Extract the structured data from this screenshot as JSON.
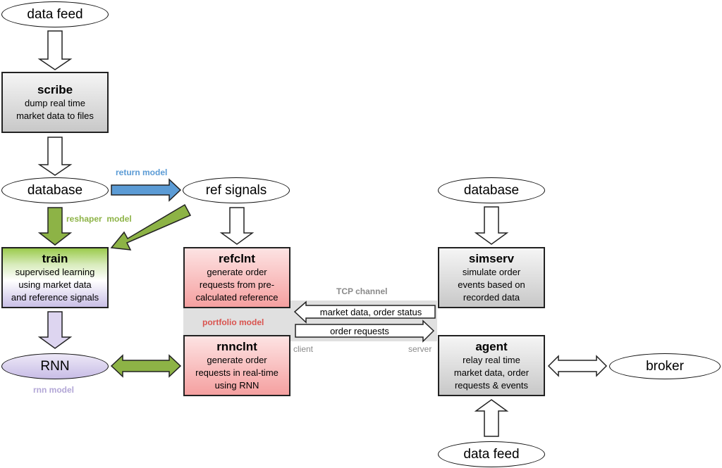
{
  "diagram": {
    "colors": {
      "return_model": "#5b9bd5",
      "reshaper_model": "#8db346",
      "rnn_model": "#b2a6d6",
      "portfolio_model": "#d9534f",
      "tcp_label": "#8a8a8a"
    },
    "ellipses": {
      "data_feed_top": "data feed",
      "database_left": "database",
      "ref_signals": "ref signals",
      "database_right": "database",
      "rnn": "RNN",
      "broker": "broker",
      "data_feed_bottom": "data feed"
    },
    "boxes": {
      "scribe": {
        "title": "scribe",
        "desc": "dump real time\nmarket data to files"
      },
      "train": {
        "title": "train",
        "desc": "supervised learning\nusing market data\nand reference signals"
      },
      "refclnt": {
        "title": "refclnt",
        "desc": "generate order\nrequests from pre-\ncalculated reference"
      },
      "rnnclnt": {
        "title": "rnnclnt",
        "desc": "generate order\nrequests in real-time\nusing RNN"
      },
      "simserv": {
        "title": "simserv",
        "desc": "simulate order\nevents based on\nrecorded data"
      },
      "agent": {
        "title": "agent",
        "desc": "relay real time\nmarket data, order\nrequests & events"
      }
    },
    "labels": {
      "return_model": "return model",
      "reshaper_model": "reshaper  model",
      "rnn_model": "rnn model",
      "portfolio_model": "portfolio model",
      "tcp_channel": "TCP channel",
      "client": "client",
      "server": "server",
      "market_data_arrow": "market data, order status",
      "order_requests_arrow": "order requests"
    }
  }
}
